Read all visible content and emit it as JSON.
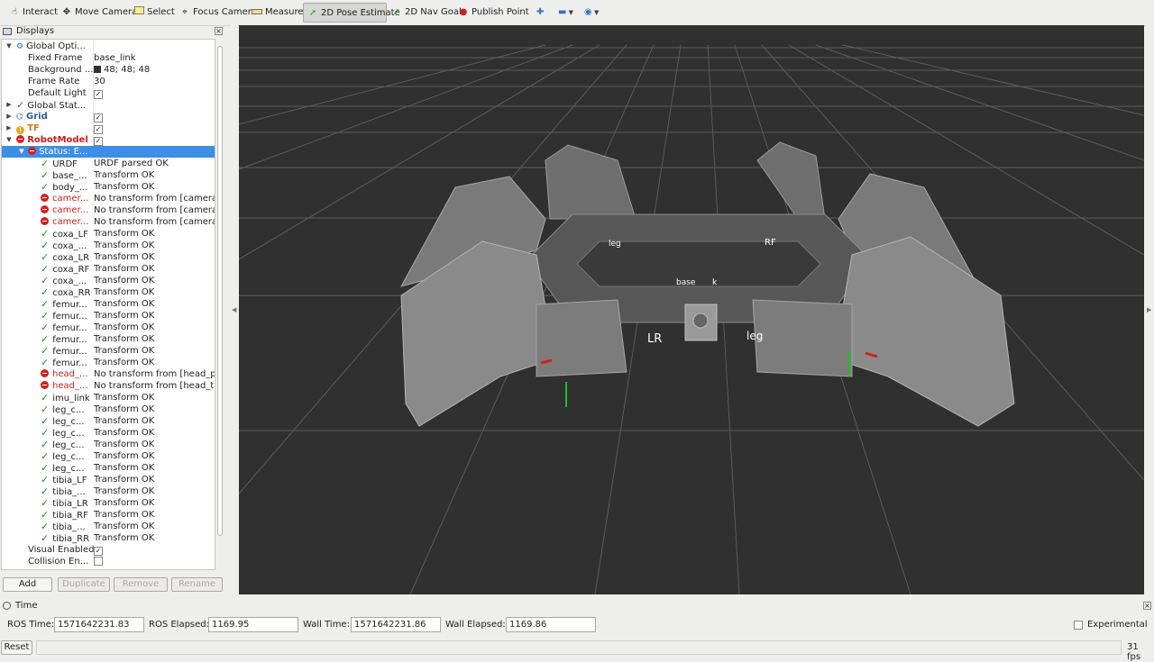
{
  "toolbar": {
    "interact": "Interact",
    "move_camera": "Move Camera",
    "select": "Select",
    "focus_camera": "Focus Camera",
    "measure": "Measure",
    "pose_estimate": "2D Pose Estimate",
    "nav_goal": "2D Nav Goal",
    "publish_point": "Publish Point"
  },
  "displays": {
    "title": "Displays",
    "close": "×",
    "global_options": "Global Opti...",
    "fixed_frame_label": "Fixed Frame",
    "fixed_frame_value": "base_link",
    "background_label": "Background ...",
    "background_value": "48; 48; 48",
    "background_color": "#303030",
    "frame_rate_label": "Frame Rate",
    "frame_rate_value": "30",
    "default_light_label": "Default Light",
    "global_status": "Global Stat...",
    "grid": "Grid",
    "tf": "TF",
    "robot_model": "RobotModel",
    "status": "Status: E...",
    "links": [
      {
        "name": "URDF",
        "value": "URDF parsed OK",
        "error": false
      },
      {
        "name": "base_...",
        "value": "Transform OK",
        "error": false
      },
      {
        "name": "body_...",
        "value": "Transform OK",
        "error": false
      },
      {
        "name": "camer...",
        "value": "No transform from [camera...",
        "error": true
      },
      {
        "name": "camer...",
        "value": "No transform from [camera...",
        "error": true
      },
      {
        "name": "camer...",
        "value": "No transform from [camera...",
        "error": true
      },
      {
        "name": "coxa_LF",
        "value": "Transform OK",
        "error": false
      },
      {
        "name": "coxa_...",
        "value": "Transform OK",
        "error": false
      },
      {
        "name": "coxa_LR",
        "value": "Transform OK",
        "error": false
      },
      {
        "name": "coxa_RF",
        "value": "Transform OK",
        "error": false
      },
      {
        "name": "coxa_...",
        "value": "Transform OK",
        "error": false
      },
      {
        "name": "coxa_RR",
        "value": "Transform OK",
        "error": false
      },
      {
        "name": "femur...",
        "value": "Transform OK",
        "error": false
      },
      {
        "name": "femur...",
        "value": "Transform OK",
        "error": false
      },
      {
        "name": "femur...",
        "value": "Transform OK",
        "error": false
      },
      {
        "name": "femur...",
        "value": "Transform OK",
        "error": false
      },
      {
        "name": "femur...",
        "value": "Transform OK",
        "error": false
      },
      {
        "name": "femur...",
        "value": "Transform OK",
        "error": false
      },
      {
        "name": "head_...",
        "value": "No transform from [head_p...",
        "error": true
      },
      {
        "name": "head_...",
        "value": "No transform from [head_til...",
        "error": true
      },
      {
        "name": "imu_link",
        "value": "Transform OK",
        "error": false
      },
      {
        "name": "leg_c...",
        "value": "Transform OK",
        "error": false
      },
      {
        "name": "leg_c...",
        "value": "Transform OK",
        "error": false
      },
      {
        "name": "leg_c...",
        "value": "Transform OK",
        "error": false
      },
      {
        "name": "leg_c...",
        "value": "Transform OK",
        "error": false
      },
      {
        "name": "leg_c...",
        "value": "Transform OK",
        "error": false
      },
      {
        "name": "leg_c...",
        "value": "Transform OK",
        "error": false
      },
      {
        "name": "tibia_LF",
        "value": "Transform OK",
        "error": false
      },
      {
        "name": "tibia_...",
        "value": "Transform OK",
        "error": false
      },
      {
        "name": "tibia_LR",
        "value": "Transform OK",
        "error": false
      },
      {
        "name": "tibia_RF",
        "value": "Transform OK",
        "error": false
      },
      {
        "name": "tibia_...",
        "value": "Transform OK",
        "error": false
      },
      {
        "name": "tibia_RR",
        "value": "Transform OK",
        "error": false
      }
    ],
    "visual_enabled": "Visual Enabled",
    "collision_enabled": "Collision En...",
    "buttons": {
      "add": "Add",
      "duplicate": "Duplicate",
      "remove": "Remove",
      "rename": "Rename"
    }
  },
  "viewport_labels": {
    "leg_lf": "leg",
    "rf": "RF",
    "base": "base",
    "k": "k",
    "lr": "LR",
    "leg_rr": "leg"
  },
  "time": {
    "title": "Time",
    "close": "×",
    "ros_time_label": "ROS Time:",
    "ros_time": "1571642231.83",
    "ros_elapsed_label": "ROS Elapsed:",
    "ros_elapsed": "1169.95",
    "wall_time_label": "Wall Time:",
    "wall_time": "1571642231.86",
    "wall_elapsed_label": "Wall Elapsed:",
    "wall_elapsed": "1169.86",
    "experimental": "Experimental"
  },
  "status": {
    "reset": "Reset",
    "fps": "31 fps"
  }
}
